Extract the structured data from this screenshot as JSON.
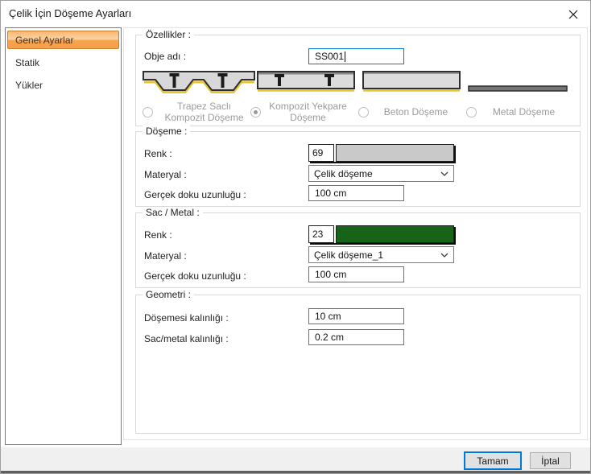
{
  "window": {
    "title": "Çelik İçin Döşeme Ayarları"
  },
  "sidebar": {
    "items": [
      {
        "label": "Genel Ayarlar",
        "selected": true
      },
      {
        "label": "Statik",
        "selected": false
      },
      {
        "label": "Yükler",
        "selected": false
      }
    ]
  },
  "groups": {
    "ozellikler": {
      "legend": "Özellikler :",
      "obje_adi": {
        "label": "Obje adı :",
        "value": "SS001"
      },
      "options": [
        {
          "line1": "Trapez Saclı",
          "line2": "Kompozit Döşeme",
          "selected": false
        },
        {
          "line1": "Kompozit Yekpare",
          "line2": "Döşeme",
          "selected": true
        },
        {
          "line1": "Beton Döşeme",
          "line2": "",
          "selected": false
        },
        {
          "line1": "Metal Döşeme",
          "line2": "",
          "selected": false
        }
      ]
    },
    "doseme": {
      "legend": "Döşeme :",
      "renk": {
        "label": "Renk :",
        "value": "69",
        "color": "#c9c9c9"
      },
      "materyal": {
        "label": "Materyal :",
        "value": "Çelik döşeme"
      },
      "doku": {
        "label": "Gerçek doku uzunluğu :",
        "value": "100 cm"
      }
    },
    "sac_metal": {
      "legend": "Sac / Metal :",
      "renk": {
        "label": "Renk :",
        "value": "23",
        "color": "#176419"
      },
      "materyal": {
        "label": "Materyal :",
        "value": "Çelik döşeme_1"
      },
      "doku": {
        "label": "Gerçek doku uzunluğu :",
        "value": "100 cm"
      }
    },
    "geometri": {
      "legend": "Geometri :",
      "kalinlik": {
        "label": "Döşemesi kalınlığı :",
        "value": "10 cm"
      },
      "sac_kalinlik": {
        "label": "Sac/metal kalınlığı :",
        "value": "0.2 cm"
      }
    }
  },
  "footer": {
    "ok": "Tamam",
    "cancel": "İptal"
  },
  "icons": {
    "close": "close-icon",
    "combo_chevron": "chevron-down-icon"
  },
  "colors": {
    "focus_blue": "#0078d7",
    "selected_orange": "#f7a24d",
    "selected_orange_border": "#c98033",
    "deck_yellow": "#e8c531",
    "footer_bg": "#f0f0f0"
  }
}
